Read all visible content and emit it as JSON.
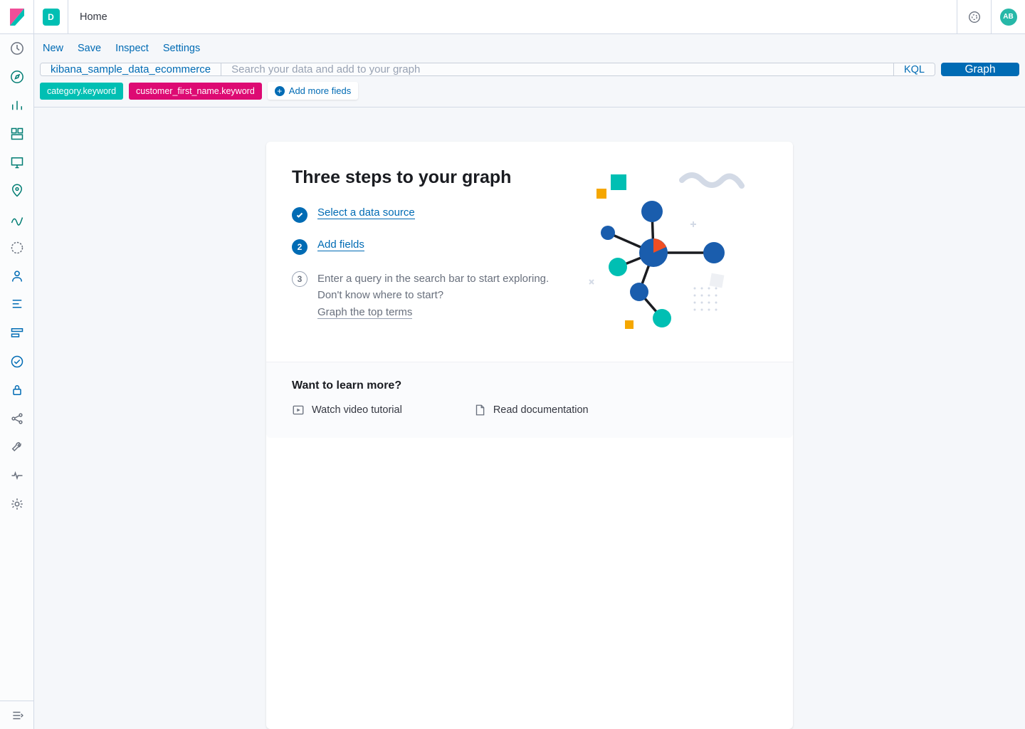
{
  "header": {
    "space_initial": "D",
    "breadcrumb": "Home",
    "user_initials": "AB"
  },
  "submenu": {
    "new": "New",
    "save": "Save",
    "inspect": "Inspect",
    "settings": "Settings"
  },
  "search": {
    "datasource": "kibana_sample_data_ecommerce",
    "placeholder": "Search your data and add to your graph",
    "kql": "KQL",
    "graph_btn": "Graph"
  },
  "fields": {
    "pills": [
      {
        "label": "category.keyword",
        "color": "teal"
      },
      {
        "label": "customer_first_name.keyword",
        "color": "pink"
      }
    ],
    "add_more": "Add more fieds"
  },
  "card": {
    "title": "Three steps to your graph",
    "steps": {
      "s1_link": "Select a data source",
      "s2_link": "Add fields",
      "s3_text_a": "Enter a query in the search bar to start exploring. Don't know where to start?",
      "s3_link": "Graph the top terms",
      "num2": "2",
      "num3": "3"
    },
    "learn": {
      "title": "Want to learn more?",
      "video": "Watch video tutorial",
      "docs": "Read documentation"
    }
  }
}
